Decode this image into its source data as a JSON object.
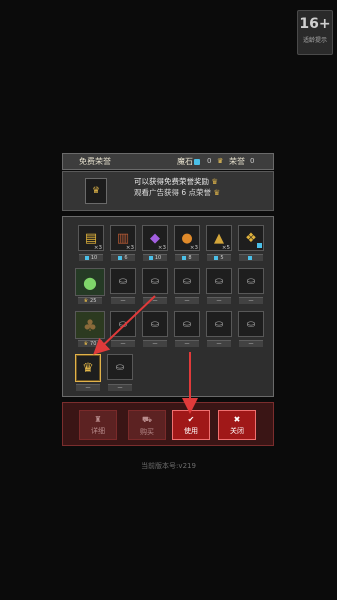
{
  "age_badge": {
    "number": "16+",
    "label": "适龄提示"
  },
  "header": {
    "title": "免费荣誉",
    "currency1_label": "魔石",
    "currency1_value": "0",
    "currency2_label": "荣誉",
    "currency2_value": "0",
    "icons": [
      "gem-icon",
      "crown-icon"
    ]
  },
  "reward": {
    "line1": "可以获得免费荣誉奖励",
    "line2": "观看广告获得 6 点荣誉"
  },
  "grid": {
    "row1": [
      {
        "icon": "gold-bars-icon",
        "count": "×3",
        "bar_value": "10",
        "bar_dot": true
      },
      {
        "icon": "book-icon",
        "count": "×3",
        "bar_value": "6",
        "bar_dot": true
      },
      {
        "icon": "purple-crystal-icon",
        "count": "×3",
        "bar_value": "10",
        "bar_dot": true
      },
      {
        "icon": "orange-pot-icon",
        "count": "×3",
        "bar_value": "8",
        "bar_dot": true
      },
      {
        "icon": "gold-idol-icon",
        "count": "×5",
        "bar_value": "5",
        "bar_dot": true
      },
      {
        "icon": "gold-coins-icon",
        "count": "",
        "bar_value": "",
        "bar_dot": true
      }
    ],
    "row2": [
      {
        "icon": "green-slime-icon",
        "bar_value": "25",
        "crown": true
      },
      {
        "icon": "lock-icon",
        "bar_value": "—"
      },
      {
        "icon": "lock-icon",
        "bar_value": "—"
      },
      {
        "icon": "lock-icon",
        "bar_value": "—"
      },
      {
        "icon": "lock-icon",
        "bar_value": "—"
      },
      {
        "icon": "lock-icon",
        "bar_value": "—"
      }
    ],
    "row3": [
      {
        "icon": "treant-icon",
        "bar_value": "70",
        "crown": true
      },
      {
        "icon": "lock-icon",
        "bar_value": "—"
      },
      {
        "icon": "lock-icon",
        "bar_value": "—"
      },
      {
        "icon": "lock-icon",
        "bar_value": "—"
      },
      {
        "icon": "lock-icon",
        "bar_value": "—"
      },
      {
        "icon": "lock-icon",
        "bar_value": "—"
      }
    ],
    "row4": [
      {
        "icon": "crown-icon",
        "bar_value": "—",
        "selected": true
      },
      {
        "icon": "lock-icon",
        "bar_value": "—"
      }
    ]
  },
  "buttons": {
    "detail": "详细",
    "buy": "购买",
    "use": "使用",
    "close": "关闭"
  },
  "version": "当前版本号:v219",
  "colors": {
    "gem": "#4bc0e8",
    "crown": "#e4b84a",
    "active_button": "#a01818",
    "arrow": "#e03a3a"
  }
}
